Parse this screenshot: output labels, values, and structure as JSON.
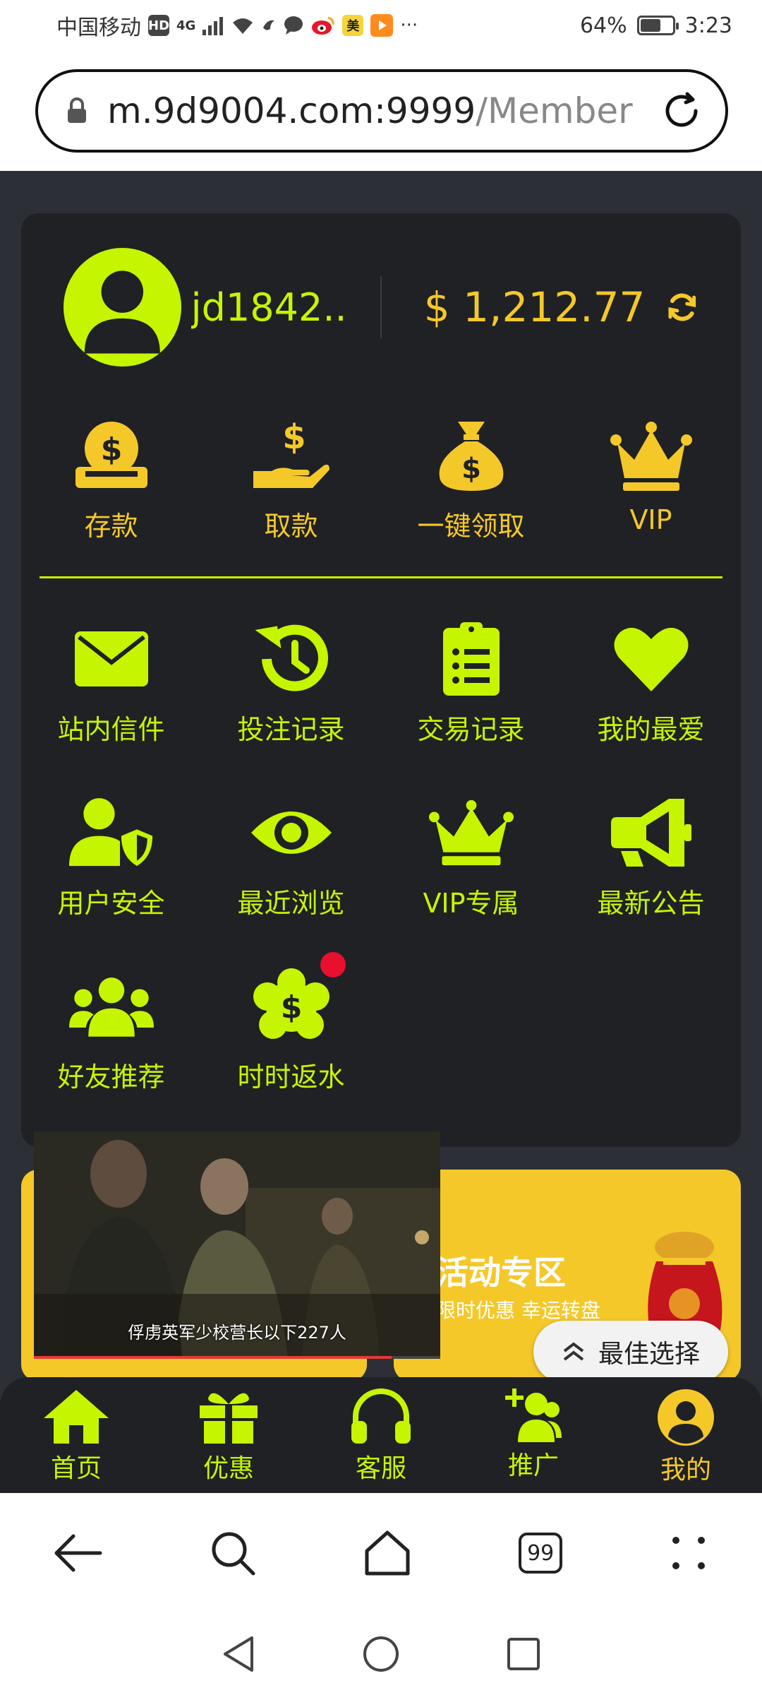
{
  "status_bar": {
    "carrier": "中国移动",
    "hd": "HD",
    "network": "4G",
    "battery": "64%",
    "battery_level": 0.64,
    "time": "3:23",
    "app_badge_mei": "美"
  },
  "browser": {
    "url_host": "m.9d9004.com:9999",
    "url_path": "/Member",
    "tabs_count": "99"
  },
  "member": {
    "username": "jd1842...",
    "balance": "$ 1,212.77"
  },
  "quick_actions": [
    {
      "label": "存款",
      "icon": "coin-deposit-icon"
    },
    {
      "label": "取款",
      "icon": "withdraw-hand-icon"
    },
    {
      "label": "一键领取",
      "icon": "money-bag-icon"
    },
    {
      "label": "VIP",
      "icon": "crown-icon"
    }
  ],
  "menu_items": [
    {
      "label": "站内信件",
      "icon": "envelope-icon"
    },
    {
      "label": "投注记录",
      "icon": "history-icon"
    },
    {
      "label": "交易记录",
      "icon": "clipboard-list-icon"
    },
    {
      "label": "我的最爱",
      "icon": "heart-icon"
    },
    {
      "label": "用户安全",
      "icon": "user-shield-icon"
    },
    {
      "label": "最近浏览",
      "icon": "eye-icon"
    },
    {
      "label": "VIP专属",
      "icon": "crown-icon"
    },
    {
      "label": "最新公告",
      "icon": "megaphone-icon"
    },
    {
      "label": "好友推荐",
      "icon": "users-icon"
    },
    {
      "label": "时时返水",
      "icon": "dollar-badge-icon"
    }
  ],
  "banners": {
    "right_title": "活动专区",
    "right_sub": "限时优惠 幸运转盘"
  },
  "video": {
    "subtitle": "俘虏英军少校营长以下227人",
    "progress": 0.88
  },
  "best_choice": "最佳选择",
  "site_nav": [
    {
      "label": "首页",
      "icon": "home-icon"
    },
    {
      "label": "优惠",
      "icon": "gift-icon"
    },
    {
      "label": "客服",
      "icon": "headphones-icon"
    },
    {
      "label": "推广",
      "icon": "user-plus-icon"
    },
    {
      "label": "我的",
      "icon": "user-circle-icon"
    }
  ],
  "colors": {
    "lime": "#c6f500",
    "gold": "#f5c82a",
    "card_bg": "#1f2125",
    "page_bg": "#2d2f36"
  }
}
